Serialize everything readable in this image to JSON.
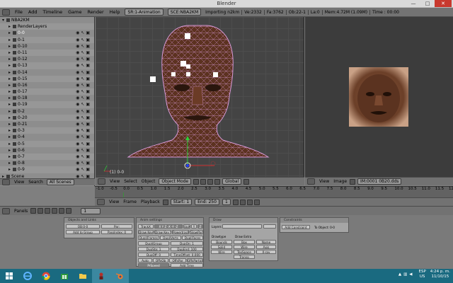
{
  "window": {
    "title": "Blender",
    "min": "—",
    "max": "□",
    "close": "✕"
  },
  "topbar": {
    "menus": [
      "File",
      "Add",
      "Timeline",
      "Game",
      "Render",
      "Help"
    ],
    "screen": "SR:1-Animation",
    "scene": "SCE:NBA2KM",
    "status": "Importing n2km",
    "stats": [
      "Ve:2332",
      "Fa:3762",
      "Ob:22-1",
      "La:0",
      "Mem:4.72M (1.09M)",
      "Time : 00:00"
    ]
  },
  "outliner": {
    "items": [
      {
        "label": "NBA2KM",
        "expand": "▾"
      },
      {
        "label": "RenderLayers",
        "expand": "▸"
      },
      {
        "label": "0-0",
        "expand": "▸",
        "selected": true
      },
      {
        "label": "0-1",
        "expand": "▸"
      },
      {
        "label": "0-10",
        "expand": "▸"
      },
      {
        "label": "0-11",
        "expand": "▸"
      },
      {
        "label": "0-12",
        "expand": "▸"
      },
      {
        "label": "0-13",
        "expand": "▸"
      },
      {
        "label": "0-14",
        "expand": "▸"
      },
      {
        "label": "0-15",
        "expand": "▸"
      },
      {
        "label": "0-16",
        "expand": "▸"
      },
      {
        "label": "0-17",
        "expand": "▸"
      },
      {
        "label": "0-18",
        "expand": "▸"
      },
      {
        "label": "0-19",
        "expand": "▸"
      },
      {
        "label": "0-2",
        "expand": "▸"
      },
      {
        "label": "0-20",
        "expand": "▸"
      },
      {
        "label": "0-21",
        "expand": "▸"
      },
      {
        "label": "0-3",
        "expand": "▸"
      },
      {
        "label": "0-4",
        "expand": "▸"
      },
      {
        "label": "0-5",
        "expand": "▸"
      },
      {
        "label": "0-6",
        "expand": "▸"
      },
      {
        "label": "0-7",
        "expand": "▸"
      },
      {
        "label": "0-8",
        "expand": "▸"
      },
      {
        "label": "0-9",
        "expand": "▸"
      },
      {
        "label": "Scene",
        "expand": "▸"
      }
    ],
    "header": {
      "view": "View",
      "search": "Search",
      "scope": "All Scenes"
    }
  },
  "viewport": {
    "label": "(1) 0-0",
    "header": {
      "view": "View",
      "select": "Select",
      "object": "Object",
      "mode": "Object Mode",
      "orientation": "Global"
    }
  },
  "image_editor": {
    "header": {
      "view": "View",
      "image": "Image",
      "image_name": "IM:0001 0B20.dds"
    }
  },
  "timeline": {
    "ticks": [
      "-1.0",
      "-0.5",
      "0.0",
      "0.5",
      "1.0",
      "1.5",
      "2.0",
      "2.5",
      "3.0",
      "3.5",
      "4.0",
      "4.5",
      "5.0",
      "5.5",
      "6.0",
      "6.5",
      "7.0",
      "7.5",
      "8.0",
      "8.5",
      "9.0",
      "9.5",
      "10.0",
      "10.5",
      "11.0",
      "11.5",
      "12.0"
    ],
    "header": {
      "view": "View",
      "frame": "Frame",
      "playback": "Playback",
      "start": "Start: 1",
      "end": "End: 250",
      "current": "1"
    }
  },
  "buttons_window": {
    "header": {
      "panels": "Panels",
      "frame": "1"
    },
    "panels": {
      "links": {
        "title": "Objects and Links",
        "ob": "OB:0-0",
        "par": "Par:",
        "add_group": "Add to Group",
        "pass": "PassIndex: 0"
      },
      "anim": {
        "title": "Anim settings",
        "tracky": "TrackX",
        "axes": "X  Y  Z  -X  -Y  -Z",
        "upx": "UpX",
        "upy": "Y",
        "upz": "Z",
        "draw_key": "Draw Key",
        "draw_key_sel": "Draw Key Sel",
        "powertrack": "Powertrack",
        "slow_par": "SlowPar",
        "dupli_frames": "DupliFrames",
        "dupli_verts": "DupliVerts",
        "dupli_faces": "DupliFaces",
        "dupli_group": "DupliGroup",
        "dupsta": "DupSta: 1",
        "dupend": "DupEnd: 100",
        "dupon": "DupOn: 1",
        "dupoff": "DupOff: 0",
        "timeoffset": "TimeOffset: 0.000",
        "auto": "Auto",
        "offob": "OffsOb",
        "offpar": "OffsPar",
        "offparticle": "OffsParticle",
        "prspeed": "PrSpeed",
        "addtime": "Add Time"
      },
      "draw": {
        "title": "Draw",
        "layers": "Layers",
        "pass_label": "Drawtype",
        "bounds": "Bounds",
        "solid": "Solid",
        "wire": "Wire",
        "draw_extra": "Draw Extra",
        "name": "Name",
        "axis": "Axis",
        "texspace": "TexSpace",
        "xray": "X-ray",
        "transp": "Transp",
        "bounds_v": "Box",
        "wire_v": "Wire"
      },
      "constraints": {
        "title": "Constraints",
        "add": "Add Constraint",
        "to": "To Object: 0-0"
      }
    }
  },
  "taskbar": {
    "lang": "ESP",
    "lang2": "US",
    "time": "4:24 p. m.",
    "date": "11/10/15"
  },
  "colors": {
    "mesh_wire": "#d89ad8",
    "skin": "#5c3220",
    "taskbar": "#1a6a80"
  }
}
